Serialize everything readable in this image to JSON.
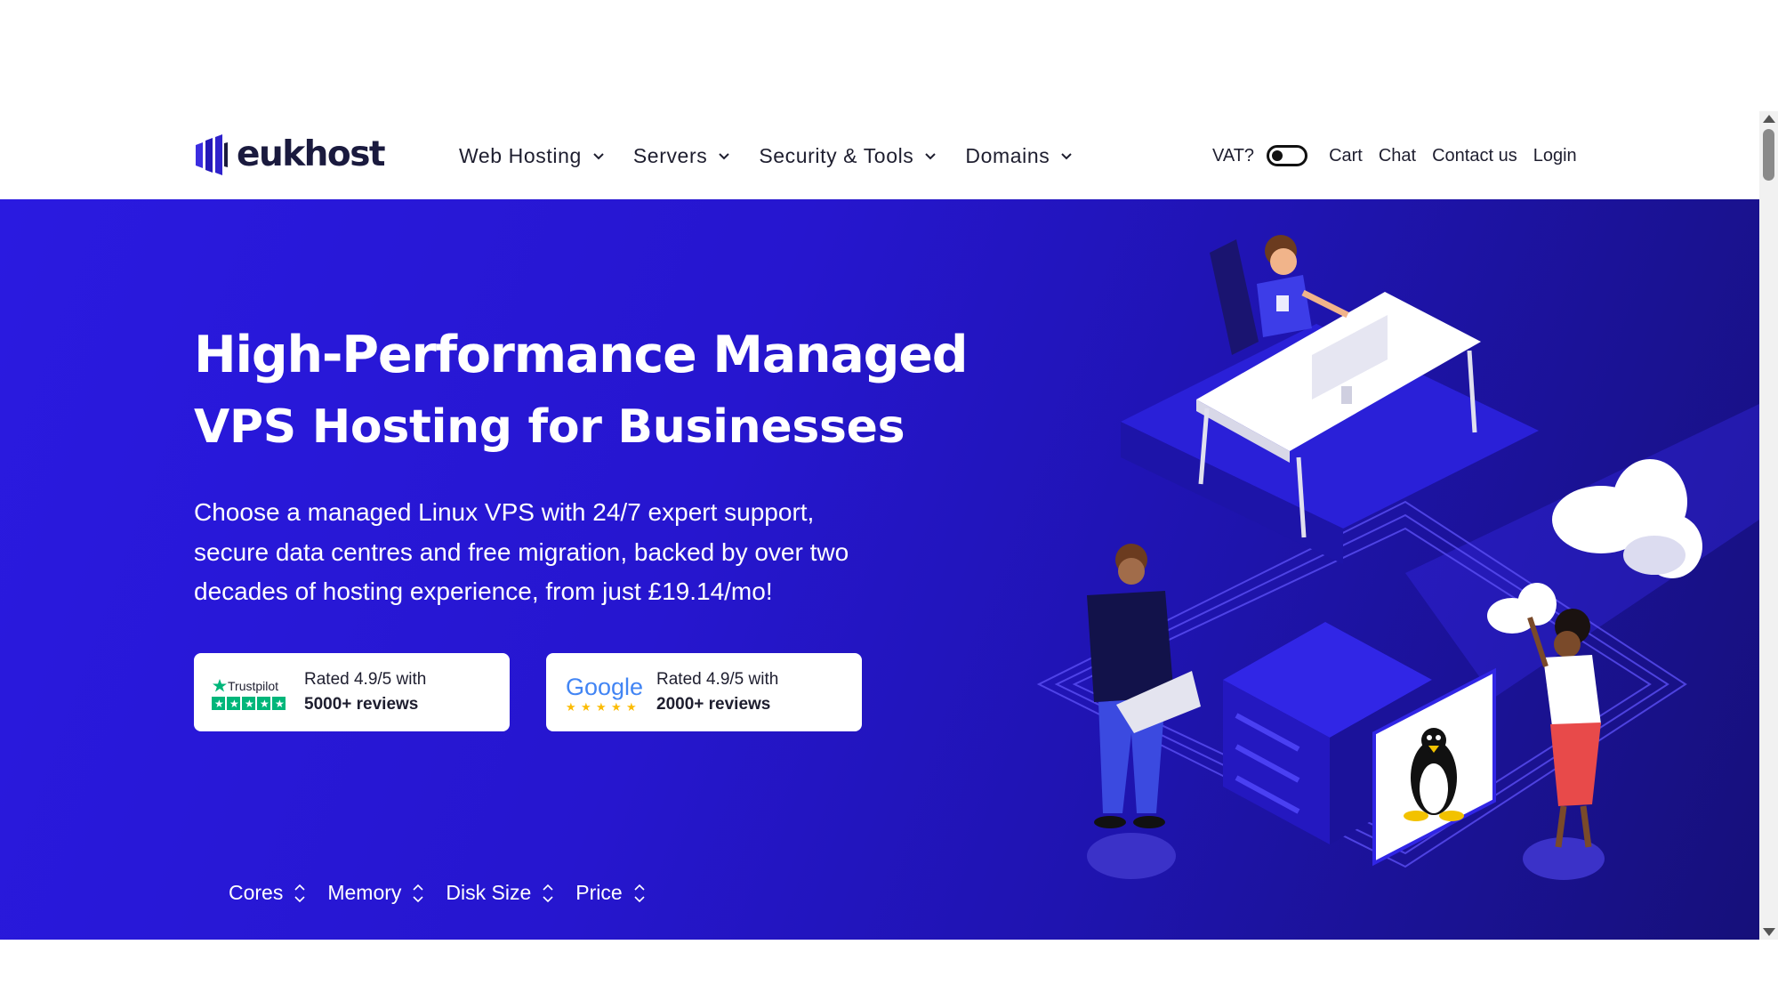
{
  "header": {
    "logo_text": "eukhost",
    "nav": [
      {
        "label": "Web Hosting"
      },
      {
        "label": "Servers"
      },
      {
        "label": "Security & Tools"
      },
      {
        "label": "Domains"
      }
    ],
    "vat_label": "VAT?",
    "vat_enabled": false,
    "links": {
      "cart": "Cart",
      "chat": "Chat",
      "contact": "Contact us",
      "login": "Login"
    }
  },
  "hero": {
    "title_bold": "High-Performance Managed",
    "title_regular": "VPS Hosting for Businesses",
    "lead": "Choose a managed Linux VPS with 24/7 expert support, secure data centres and free migration, backed by over two decades of hosting experience, from just £19.14/mo!",
    "trustpilot": {
      "brand": "Trustpilot",
      "line1": "Rated 4.9/5 with",
      "line2": "5000+ reviews",
      "stars": 5
    },
    "google": {
      "brand": "Google",
      "line1": "Rated 4.9/5 with",
      "line2": "2000+ reviews",
      "stars": 5
    },
    "sort": [
      {
        "label": "Cores"
      },
      {
        "label": "Memory"
      },
      {
        "label": "Disk Size"
      },
      {
        "label": "Price"
      }
    ]
  },
  "colors": {
    "hero_bg": "#2a1ae0",
    "trustpilot_green": "#00b67a",
    "google_blue": "#4285f4",
    "google_red": "#ea4335",
    "google_yellow": "#fbbc05",
    "google_green": "#34a853"
  }
}
